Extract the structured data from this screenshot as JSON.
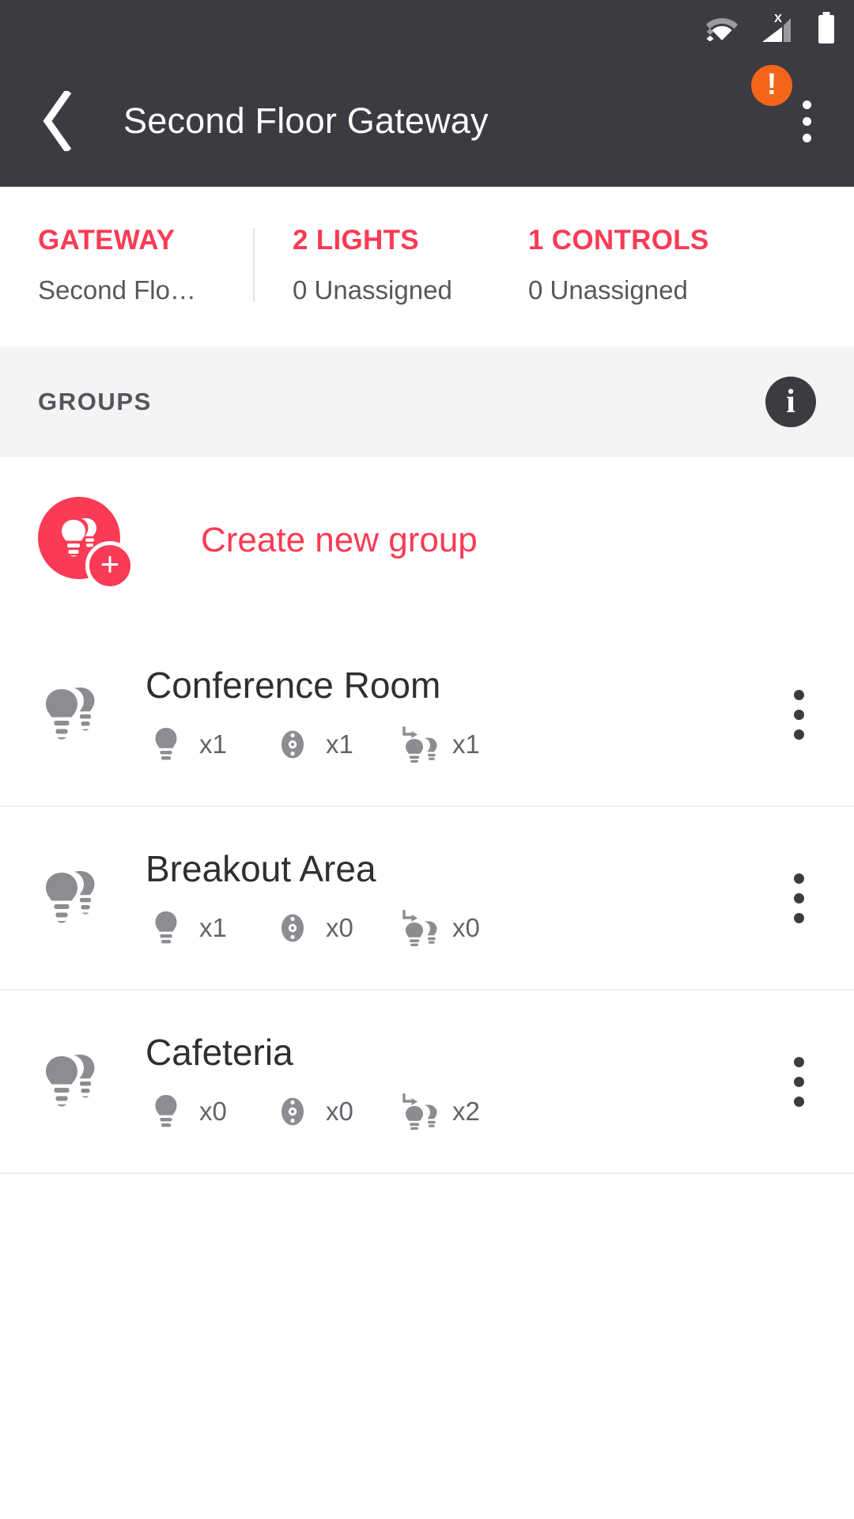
{
  "statusbar": {
    "icons": [
      {
        "name": "wifi-icon",
        "label": "wifi"
      },
      {
        "name": "cellular-signal-x-icon",
        "label": "cellular-no-service",
        "overlay": "X"
      },
      {
        "name": "battery-full-icon",
        "label": "battery"
      }
    ]
  },
  "appbar": {
    "back_label": "Back",
    "title": "Second Floor Gateway",
    "warning_glyph": "!",
    "overflow_label": "More options",
    "background": "#3b3b41"
  },
  "stats": [
    {
      "title": "GATEWAY",
      "sub": "Second Flo…"
    },
    {
      "title": "2 LIGHTS",
      "sub": "0 Unassigned"
    },
    {
      "title": "1 CONTROLS",
      "sub": "0 Unassigned"
    }
  ],
  "section": {
    "title": "GROUPS",
    "info_glyph": "i"
  },
  "create": {
    "label": "Create new group",
    "plus_glyph": "+"
  },
  "groups": [
    {
      "name": "Conference Room",
      "metrics": [
        {
          "icon": "bulb-icon",
          "count": "x1"
        },
        {
          "icon": "control-dimmer-icon",
          "count": "x1"
        },
        {
          "icon": "scene-bulbs-icon",
          "count": "x1"
        }
      ]
    },
    {
      "name": "Breakout Area",
      "metrics": [
        {
          "icon": "bulb-icon",
          "count": "x1"
        },
        {
          "icon": "control-dimmer-icon",
          "count": "x0"
        },
        {
          "icon": "scene-bulbs-icon",
          "count": "x0"
        }
      ]
    },
    {
      "name": "Cafeteria",
      "metrics": [
        {
          "icon": "bulb-icon",
          "count": "x0"
        },
        {
          "icon": "control-dimmer-icon",
          "count": "x0"
        },
        {
          "icon": "scene-bulbs-icon",
          "count": "x2"
        }
      ]
    }
  ],
  "colors": {
    "accent": "#f93b55",
    "appbar": "#3b3b41",
    "warning": "#f4651a",
    "section_bg": "#f4f4f4",
    "icon_gray": "#8c8c91",
    "divider": "#ededed"
  }
}
